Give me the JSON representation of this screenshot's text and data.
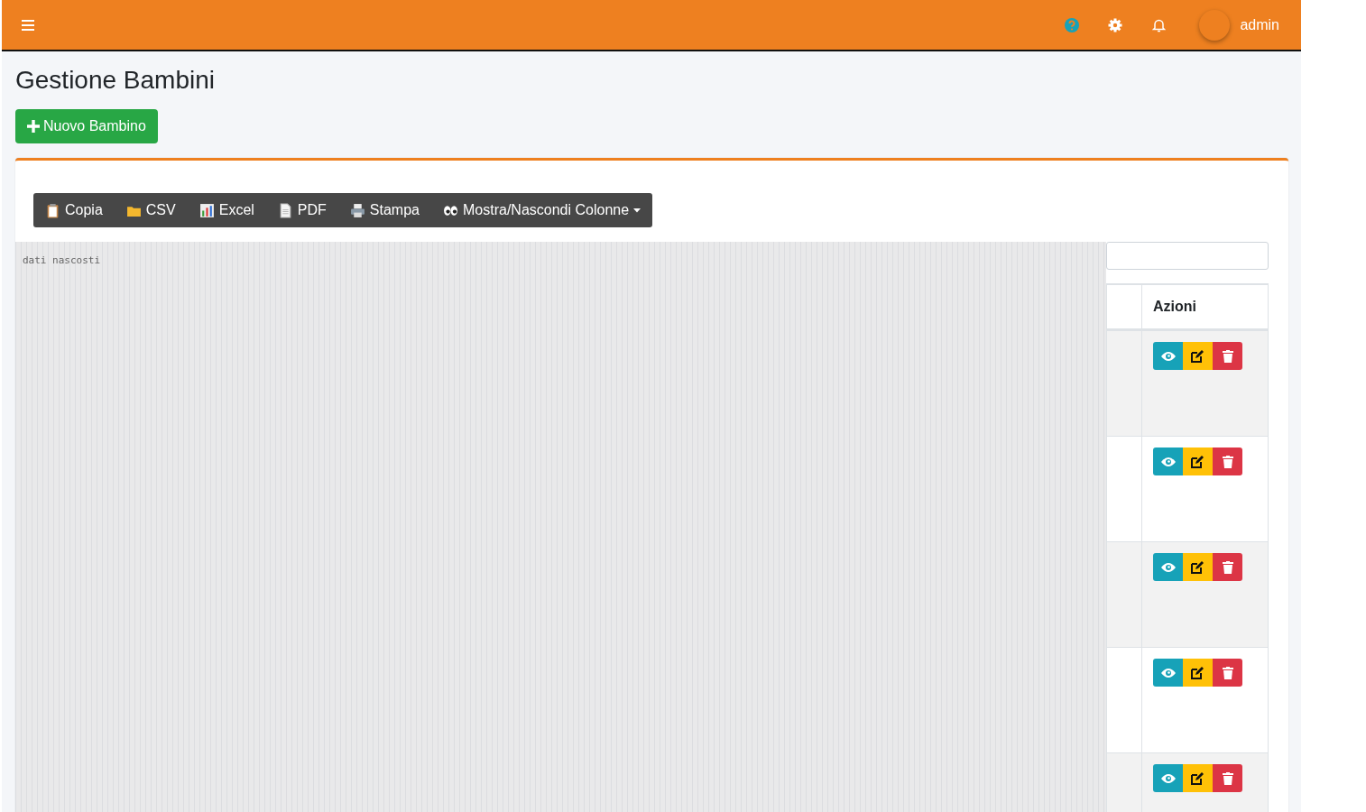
{
  "topbar": {
    "user": "admin"
  },
  "title": "Gestione Bambini",
  "new_button": {
    "label": "Nuovo Bambino"
  },
  "export_buttons": [
    {
      "kind": "clipboard",
      "label": "Copia"
    },
    {
      "kind": "folder",
      "label": "CSV"
    },
    {
      "kind": "chart",
      "label": "Excel"
    },
    {
      "kind": "document",
      "label": "PDF"
    },
    {
      "kind": "printer",
      "label": "Stampa"
    },
    {
      "kind": "eyes",
      "label": "Mostra/Nascondi Colonne",
      "dropdown": true
    }
  ],
  "hidden_area": {
    "text": "dati nascosti"
  },
  "table": {
    "columns": [
      "Azioni"
    ],
    "rows": [
      {
        "kind": "actions"
      },
      {
        "kind": "actions"
      },
      {
        "kind": "actions"
      },
      {
        "kind": "actions"
      },
      {
        "kind": "actions"
      }
    ]
  }
}
